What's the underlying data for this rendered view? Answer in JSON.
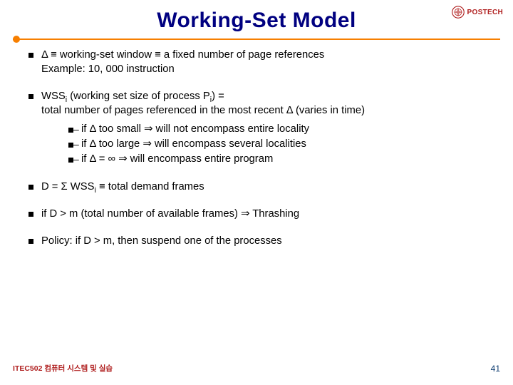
{
  "header": {
    "title": "Working-Set Model",
    "logo_text": "POSTECH"
  },
  "bullets": {
    "b1_line1": "Δ ≡ working-set window ≡ a fixed number of page references",
    "b1_line2": "Example:  10, 000 instruction",
    "b2_line1_a": "WSS",
    "b2_line1_b": " (working set size of process P",
    "b2_line1_c": ") =",
    "b2_line2": "total number of pages referenced in the most recent Δ (varies in time)",
    "sub_i": "i",
    "s1": "if Δ too small ⇒ will not encompass entire locality",
    "s2": "if Δ too large ⇒ will encompass several localities",
    "s3": "if Δ = ∞ ⇒ will encompass entire program",
    "b3_a": "D = Σ WSS",
    "b3_b": " ≡ total demand frames",
    "b4": "if D > m (total number of available frames)  ⇒ Thrashing",
    "b5": "Policy: if D > m, then suspend one of the processes"
  },
  "footer": {
    "course": "ITEC502 컴퓨터 시스템 및 실습",
    "page": "41"
  }
}
